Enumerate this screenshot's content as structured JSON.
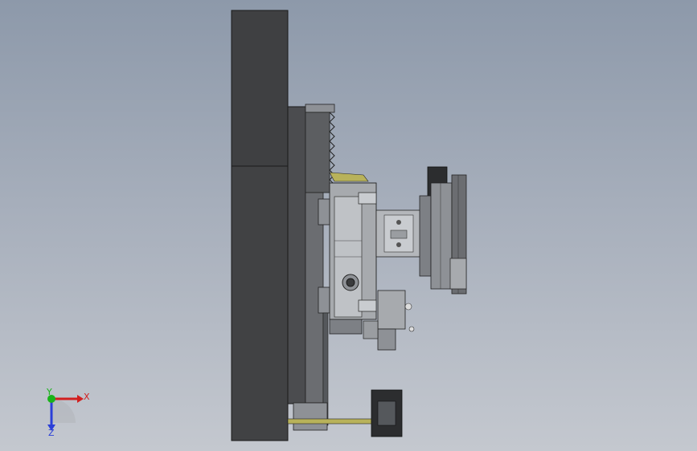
{
  "viewport": {
    "background_top": "#8d99aa",
    "background_bottom": "#c4c8cf"
  },
  "model": {
    "body_color": "#3f4042",
    "edge_color": "#1a1a1a",
    "metal_light": "#b9bcc0",
    "metal_mid": "#8e9196",
    "metal_dark": "#55585c",
    "accent_yellow": "#b8b25a"
  },
  "triad": {
    "x_label": "X",
    "y_label": "Y",
    "z_label": "Z",
    "x_color": "#d21f1f",
    "y_color": "#19b319",
    "z_color": "#2a3fd8"
  }
}
